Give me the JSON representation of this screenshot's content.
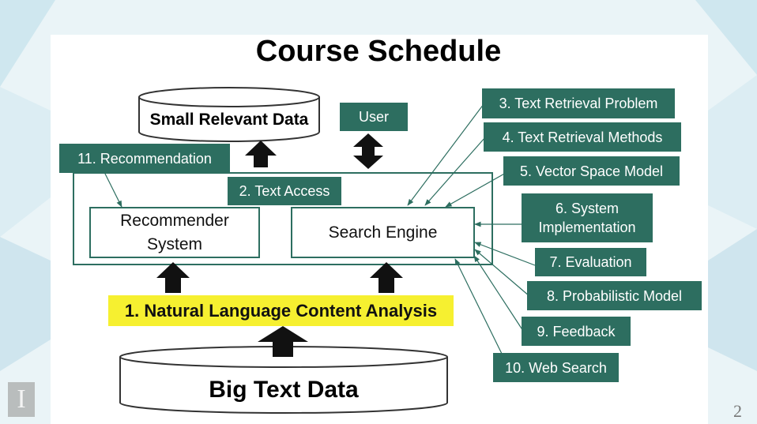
{
  "title": "Course Schedule",
  "page_number": "2",
  "logo_glyph": "I",
  "store": {
    "small": "Small Relevant Data",
    "big": "Big Text Data"
  },
  "user_label": "User",
  "text_access": "2. Text Access",
  "systems": {
    "recommender": "Recommender System",
    "search": "Search Engine"
  },
  "nlp": "1. Natural Language Content Analysis",
  "topics": {
    "recommendation": "11. Recommendation",
    "t3": "3. Text Retrieval Problem",
    "t4": "4. Text Retrieval Methods",
    "t5": "5. Vector Space Model",
    "t6": "6. System Implementation",
    "t7": "7. Evaluation",
    "t8": "8. Probabilistic Model",
    "t9": "9. Feedback",
    "t10": "10. Web Search"
  },
  "colors": {
    "topic_box": "#2d6e60",
    "highlight": "#f6f030"
  }
}
